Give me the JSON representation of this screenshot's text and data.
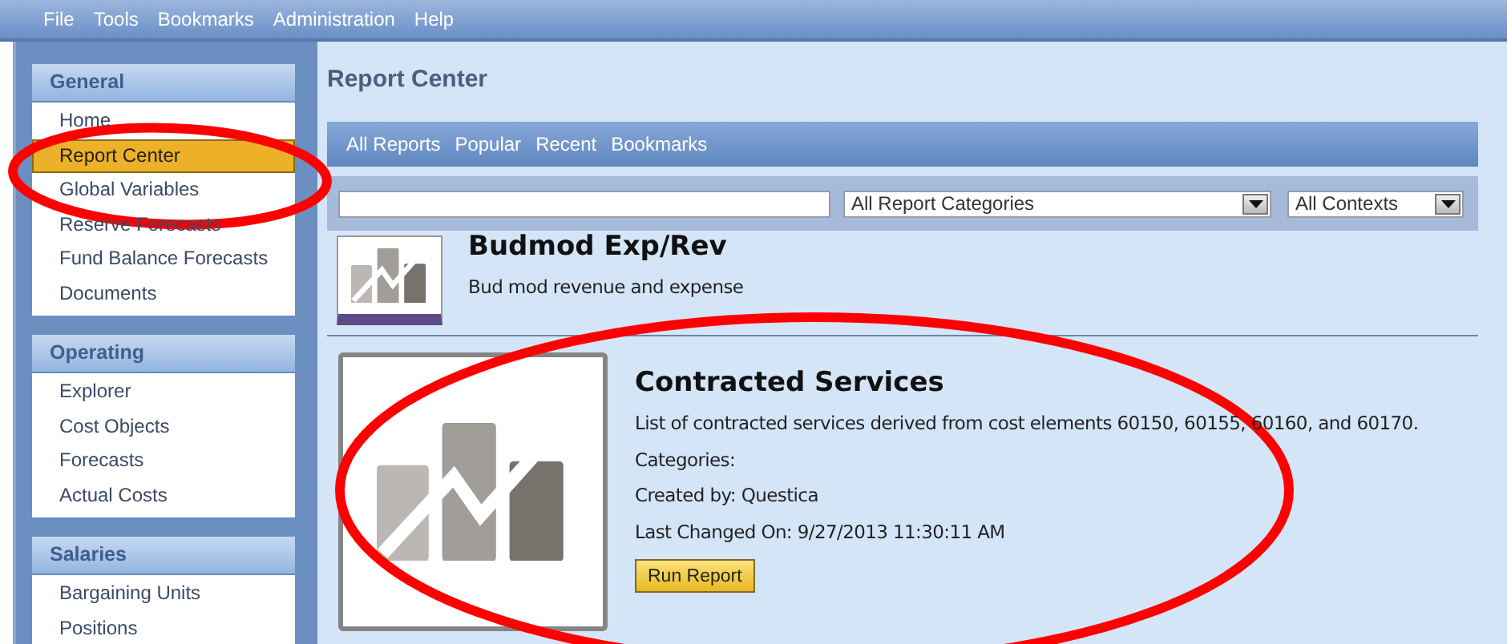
{
  "menu_bar": [
    "File",
    "Tools",
    "Bookmarks",
    "Administration",
    "Help"
  ],
  "sidebar": {
    "groups": [
      {
        "title": "General",
        "items": [
          {
            "label": "Home",
            "selected": false
          },
          {
            "label": "Report Center",
            "selected": true
          },
          {
            "label": "Global Variables",
            "selected": false
          },
          {
            "label": "Reserve Forecasts",
            "selected": false
          },
          {
            "label": "Fund Balance Forecasts",
            "selected": false
          },
          {
            "label": "Documents",
            "selected": false
          }
        ]
      },
      {
        "title": "Operating",
        "items": [
          {
            "label": "Explorer",
            "selected": false
          },
          {
            "label": "Cost Objects",
            "selected": false
          },
          {
            "label": "Forecasts",
            "selected": false
          },
          {
            "label": "Actual Costs",
            "selected": false
          }
        ]
      },
      {
        "title": "Salaries",
        "items": [
          {
            "label": "Bargaining Units",
            "selected": false
          },
          {
            "label": "Positions",
            "selected": false
          }
        ]
      }
    ]
  },
  "main": {
    "title": "Report Center",
    "tabs": [
      {
        "label": "All Reports",
        "selected": false
      },
      {
        "label": "Popular",
        "selected": false
      },
      {
        "label": "Recent",
        "selected": false
      },
      {
        "label": "Bookmarks",
        "selected": false
      }
    ],
    "filters": {
      "categories": "All Report Categories",
      "contexts": "All Contexts"
    },
    "reports": [
      {
        "kind": "compact",
        "title": "Budmod Exp/Rev",
        "description": "Bud mod revenue and expense"
      },
      {
        "kind": "expanded",
        "title": "Contracted Services",
        "description": "List of contracted services derived from cost elements 60150, 60155, 60160, and 60170.",
        "categories": "Categories:",
        "created_by": "Created by: Questica",
        "last_changed": "Last Changed On: 9/27/2013 11:30:11 AM",
        "button": "Run Report"
      }
    ]
  },
  "annotations": [
    {
      "kind": "ellipse"
    },
    {
      "kind": "ellipse"
    }
  ]
}
